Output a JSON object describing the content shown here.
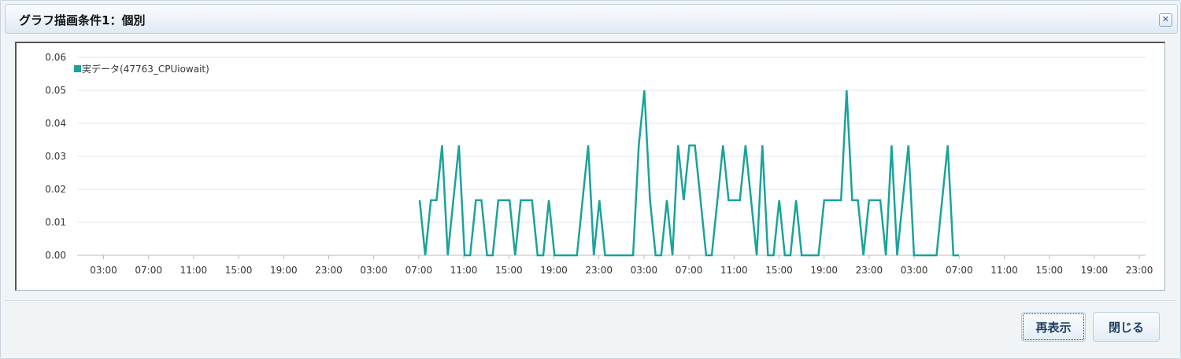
{
  "dialog": {
    "title": "グラフ描画条件1：個別",
    "close_icon": "close-icon"
  },
  "buttons": {
    "redisplay": "再表示",
    "close": "閉じる"
  },
  "colors": {
    "series": "#1aa39a",
    "grid": "#e3e3e3"
  },
  "chart_data": {
    "type": "line",
    "title": "",
    "xlabel": "",
    "ylabel": "",
    "ylim": [
      0,
      0.06
    ],
    "yticks": [
      "0.00",
      "0.01",
      "0.02",
      "0.03",
      "0.04",
      "0.05",
      "0.06"
    ],
    "xticks": [
      "03:00",
      "07:00",
      "11:00",
      "15:00",
      "19:00",
      "23:00",
      "03:00",
      "07:00",
      "11:00",
      "15:00",
      "19:00",
      "23:00",
      "03:00",
      "07:00",
      "11:00",
      "15:00",
      "19:00",
      "23:00",
      "03:00",
      "07:00",
      "11:00",
      "15:00",
      "19:00",
      "23:00"
    ],
    "legend": "top-left",
    "grid": true,
    "series": [
      {
        "name": "実データ(47763_CPUiowait)",
        "values": [
          0.0167,
          0,
          0.0167,
          0.0167,
          0.0333,
          0,
          0.0167,
          0.0333,
          0,
          0,
          0.0167,
          0.0167,
          0,
          0,
          0.0167,
          0.0167,
          0.0167,
          0,
          0.0167,
          0.0167,
          0.0167,
          0,
          0,
          0.0167,
          0,
          0,
          0,
          0,
          0,
          0.0167,
          0.0333,
          0,
          0.0167,
          0,
          0,
          0,
          0,
          0,
          0,
          0.0333,
          0.05,
          0.0167,
          0,
          0,
          0.0167,
          0,
          0.0333,
          0.0167,
          0.0333,
          0.0333,
          0.0167,
          0,
          0,
          0.0167,
          0.0333,
          0.0167,
          0.0167,
          0.0167,
          0.0333,
          0.0167,
          0,
          0.0333,
          0,
          0,
          0.0167,
          0,
          0,
          0.0167,
          0,
          0,
          0,
          0,
          0.0167,
          0.0167,
          0.0167,
          0.0167,
          0.05,
          0.0167,
          0.0167,
          0,
          0.0167,
          0.0167,
          0.0167,
          0,
          0.0333,
          0,
          0.0167,
          0.0333,
          0,
          0,
          0,
          0,
          0,
          0.0167,
          0.0333,
          0,
          0
        ]
      }
    ]
  }
}
